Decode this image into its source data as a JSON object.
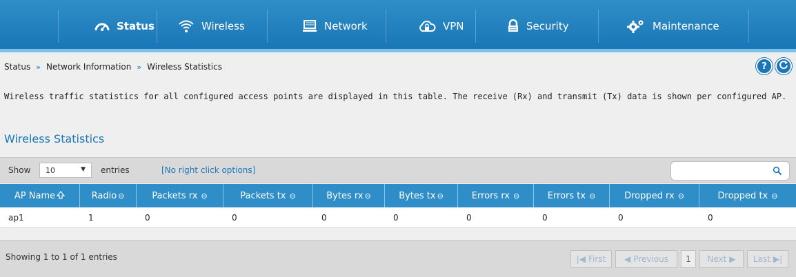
{
  "nav": {
    "items": [
      {
        "label": "Status",
        "icon": "dashboard-icon"
      },
      {
        "label": "Wireless",
        "icon": "wifi-icon"
      },
      {
        "label": "Network",
        "icon": "monitor-icon"
      },
      {
        "label": "VPN",
        "icon": "cloud-lock-icon"
      },
      {
        "label": "Security",
        "icon": "lock-icon"
      },
      {
        "label": "Maintenance",
        "icon": "gears-icon"
      }
    ]
  },
  "breadcrumb": {
    "items": [
      "Status",
      "Network Information",
      "Wireless Statistics"
    ],
    "separator": "»"
  },
  "help_button": "?",
  "description": "Wireless traffic statistics for all configured access points are displayed in this table. The receive (Rx) and transmit (Tx) data is shown per configured AP.",
  "section_title": "Wireless Statistics",
  "table_controls": {
    "show_label": "Show",
    "page_length": "10",
    "entries_label": "entries",
    "right_click_note": "[No right click options]",
    "search_value": ""
  },
  "table": {
    "headers": [
      "AP Name",
      "Radio",
      "Packets rx",
      "Packets tx",
      "Bytes rx",
      "Bytes tx",
      "Errors rx",
      "Errors tx",
      "Dropped rx",
      "Dropped tx"
    ],
    "rows": [
      [
        "ap1",
        "1",
        "0",
        "0",
        "0",
        "0",
        "0",
        "0",
        "0",
        "0"
      ]
    ]
  },
  "footer": {
    "info": "Showing 1 to 1 of 1 entries",
    "pagination": {
      "first": "First",
      "previous": "Previous",
      "current": "1",
      "next": "Next",
      "last": "Last"
    }
  },
  "colors": {
    "nav_bg": "#1a76b6",
    "accent": "#2f8ec7",
    "panel_bg": "#efefef"
  }
}
